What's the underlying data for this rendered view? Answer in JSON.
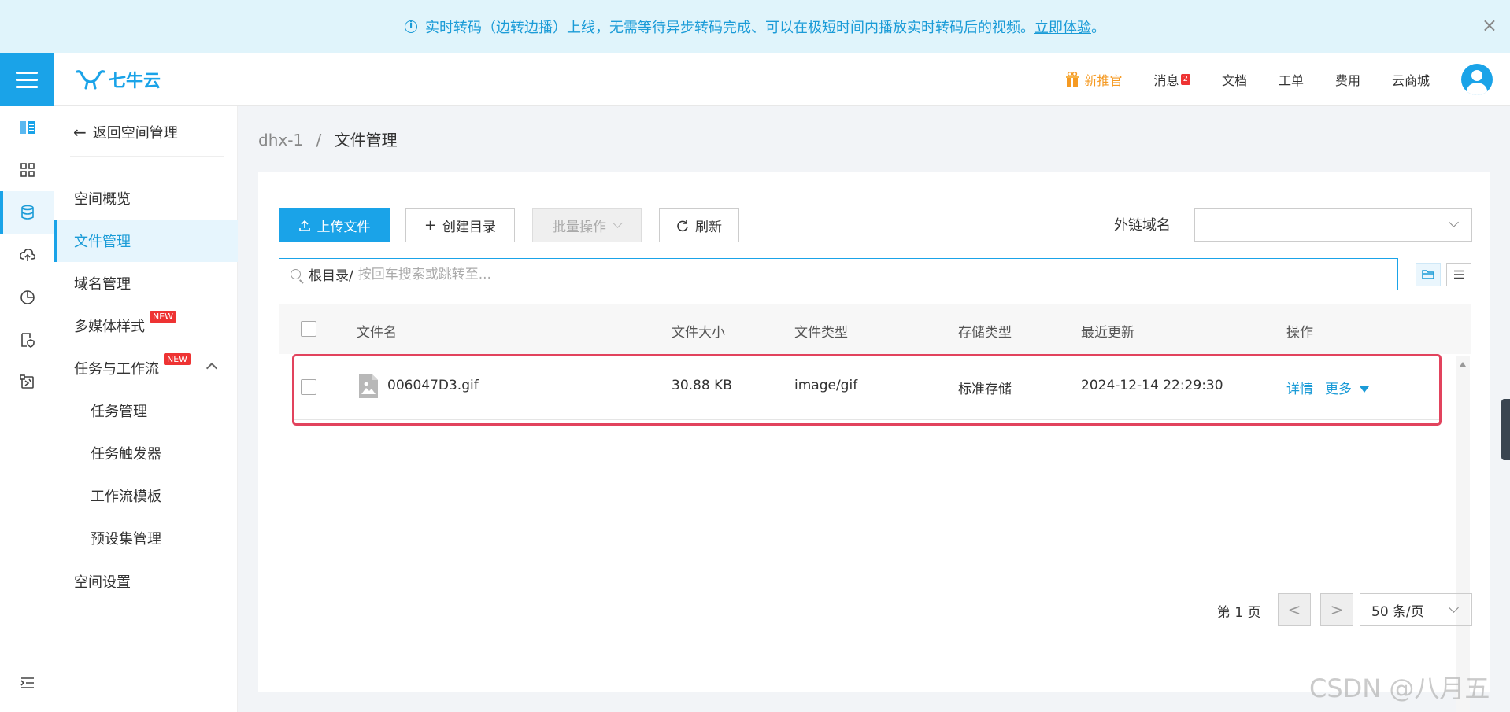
{
  "banner": {
    "text": "实时转码（边转边播）上线，无需等待异步转码完成、可以在极短时间内播放实时转码后的视频。",
    "link": "立即体验",
    "suffix": "。",
    "close": "×"
  },
  "header": {
    "logo_text": "七牛云",
    "nav": {
      "gift": "新推官",
      "messages": "消息",
      "messages_badge": "2",
      "docs": "文档",
      "tickets": "工单",
      "billing": "费用",
      "market": "云商城"
    }
  },
  "sidebar": {
    "back": "返回空间管理",
    "items": [
      {
        "label": "空间概览"
      },
      {
        "label": "文件管理"
      },
      {
        "label": "域名管理"
      },
      {
        "label": "多媒体样式",
        "badge": "NEW"
      },
      {
        "label": "任务与工作流",
        "badge": "NEW"
      },
      {
        "label": "任务管理"
      },
      {
        "label": "任务触发器"
      },
      {
        "label": "工作流模板"
      },
      {
        "label": "预设集管理"
      },
      {
        "label": "空间设置"
      }
    ]
  },
  "breadcrumb": {
    "bucket": "dhx-1",
    "sep": "/",
    "current": "文件管理"
  },
  "toolbar": {
    "upload": "上传文件",
    "mkdir": "创建目录",
    "batch": "批量操作",
    "refresh": "刷新",
    "ext_domain_label": "外链域名",
    "ext_domain_value": ""
  },
  "search": {
    "prefix": "根目录/",
    "placeholder": "按回车搜索或跳转至..."
  },
  "table": {
    "columns": [
      "文件名",
      "文件大小",
      "文件类型",
      "存储类型",
      "最近更新",
      "操作"
    ],
    "rows": [
      {
        "name": "006047D3.gif",
        "size": "30.88 KB",
        "type": "image/gif",
        "storage": "标准存储",
        "updated": "2024-12-14 22:29:30",
        "action_detail": "详情",
        "action_more": "更多"
      }
    ]
  },
  "pagination": {
    "page_label": "第 1 页",
    "prev": "<",
    "next": ">",
    "page_size": "50 条/页"
  },
  "watermark": "CSDN @八月五",
  "colors": {
    "accent": "#1aa3e8",
    "highlight": "#e2435d",
    "badge": "#ee3333",
    "gift": "#f59a23"
  }
}
